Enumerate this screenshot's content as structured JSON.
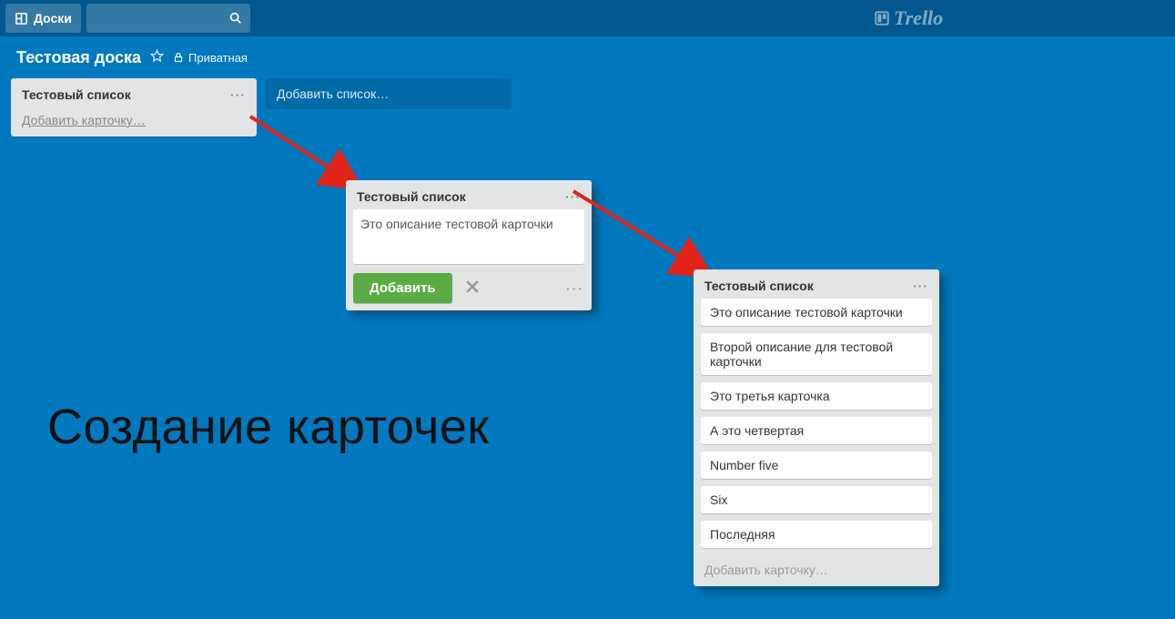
{
  "header": {
    "boards_btn": "Доски",
    "logo_text": "Trello"
  },
  "board": {
    "name": "Тестовая доска",
    "privacy_label": "Приватная"
  },
  "stage1": {
    "list_title": "Тестовый список",
    "add_card": "Добавить карточку…"
  },
  "add_list_placeholder": "Добавить список…",
  "stage2": {
    "list_title": "Тестовый список",
    "composer_text": "Это описание тестовой карточки",
    "add_btn": "Добавить"
  },
  "stage3": {
    "list_title": "Тестовый список",
    "cards": [
      "Это описание тестовой карточки",
      "Второй описание для тестовой карточки",
      "Это третья карточка",
      "А это четвертая",
      "Number five",
      "Six",
      "Последняя"
    ],
    "add_card": "Добавить карточку…"
  },
  "caption": "Создание карточек"
}
